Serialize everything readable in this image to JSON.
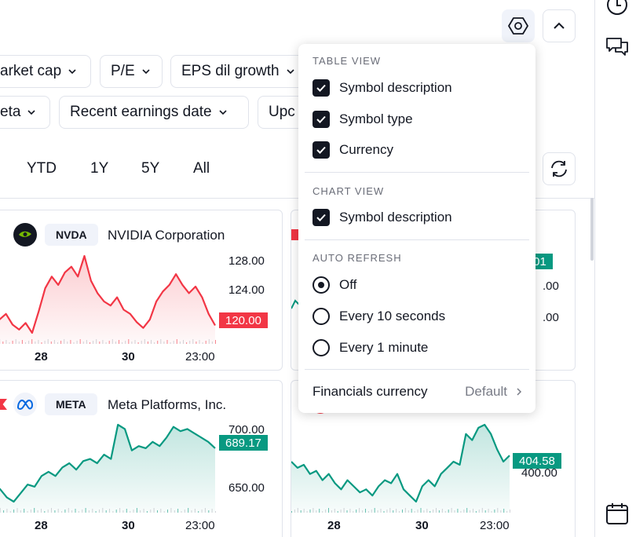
{
  "filters": {
    "row1": [
      "arket cap",
      "P/E",
      "EPS dil growth"
    ],
    "row2": [
      "eta",
      "Recent earnings date",
      "Upc"
    ]
  },
  "periods": [
    "YTD",
    "1Y",
    "5Y",
    "All"
  ],
  "cards": [
    {
      "ticker": "NVDA",
      "name": "NVIDIA Corporation",
      "y_ticks": [
        "128.00",
        "124.00"
      ],
      "price": "120.00",
      "price_color": "#f23645",
      "x_ticks": [
        "28",
        "30",
        "23:00"
      ],
      "line_color": "#f23645",
      "series": [
        122.0,
        120.8,
        121.5,
        120.2,
        119.6,
        120.4,
        119.2,
        121.8,
        124.6,
        126.0,
        125.0,
        126.5,
        127.2,
        126.0,
        128.5,
        125.5,
        124.0,
        123.0,
        122.5,
        123.5,
        122.0,
        121.5,
        120.5,
        119.8,
        120.8,
        123.0,
        124.2,
        125.0,
        126.3,
        125.0,
        124.0,
        124.8,
        123.5,
        121.5,
        120.1
      ]
    },
    {
      "ticker": "META",
      "name": "Meta Platforms, Inc.",
      "y_ticks": [
        "700.00",
        "650.00"
      ],
      "price": "689.17",
      "price_color": "#089981",
      "x_ticks": [
        "28",
        "30",
        "23:00"
      ],
      "line_color": "#089981",
      "series": [
        668,
        670,
        666,
        664,
        668,
        672,
        671,
        676,
        678,
        676,
        680,
        682,
        679,
        683,
        684,
        682,
        686,
        684,
        700,
        698,
        688,
        690,
        689,
        692,
        690,
        694,
        699,
        697,
        698,
        696,
        694,
        692,
        689
      ]
    },
    {
      "y_ticks": [
        ".00",
        ".00"
      ],
      "price": ".01",
      "price_color": "#089981",
      "line_color": "#089981"
    },
    {
      "y_ticks": [
        "400.00"
      ],
      "price": "404.58",
      "price_color": "#089981",
      "x_ticks": [
        "28",
        "30",
        "23:00"
      ],
      "line_color": "#089981",
      "series": [
        402,
        400,
        401,
        398,
        399,
        396,
        398,
        395,
        393,
        396,
        394,
        392,
        393,
        391,
        394,
        396,
        395,
        398,
        393,
        391,
        389,
        394,
        396,
        394,
        398,
        400,
        402,
        401,
        411,
        409,
        413,
        414,
        411,
        406,
        402,
        404
      ]
    }
  ],
  "menu": {
    "table_view_title": "TABLE VIEW",
    "table_options": [
      "Symbol description",
      "Symbol type",
      "Currency"
    ],
    "chart_view_title": "CHART VIEW",
    "chart_options": [
      "Symbol description"
    ],
    "auto_refresh_title": "AUTO REFRESH",
    "refresh_options": [
      "Off",
      "Every 10 seconds",
      "Every 1 minute"
    ],
    "refresh_selected": 0,
    "financials_label": "Financials currency",
    "financials_value": "Default"
  }
}
